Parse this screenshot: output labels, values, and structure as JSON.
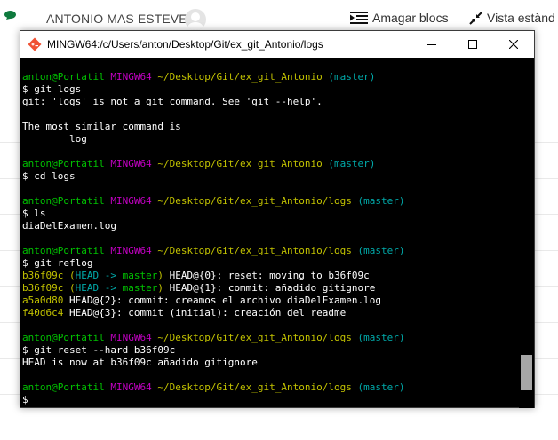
{
  "topbar": {
    "user_name": "ANTONIO MAS ESTEVE",
    "hide_blocks_label": "Amagar blocs",
    "standard_view_label": "Vista estànd"
  },
  "window": {
    "title": "MINGW64:/c/Users/anton/Desktop/Git/ex_git_Antonio/logs"
  },
  "terminal": {
    "lines": [
      {
        "segments": []
      },
      {
        "segments": [
          {
            "t": "anton@Portatil",
            "c": "green"
          },
          {
            "t": " ",
            "c": "white"
          },
          {
            "t": "MINGW64",
            "c": "purple"
          },
          {
            "t": " ",
            "c": "white"
          },
          {
            "t": "~/Desktop/Git/ex_git_Antonio",
            "c": "yellow"
          },
          {
            "t": " ",
            "c": "white"
          },
          {
            "t": "(master)",
            "c": "cyan"
          }
        ]
      },
      {
        "segments": [
          {
            "t": "$ git logs",
            "c": "white"
          }
        ]
      },
      {
        "segments": [
          {
            "t": "git: 'logs' is not a git command. See 'git --help'.",
            "c": "white"
          }
        ]
      },
      {
        "segments": []
      },
      {
        "segments": [
          {
            "t": "The most similar command is",
            "c": "white"
          }
        ]
      },
      {
        "segments": [
          {
            "t": "        log",
            "c": "white"
          }
        ]
      },
      {
        "segments": []
      },
      {
        "segments": [
          {
            "t": "anton@Portatil",
            "c": "green"
          },
          {
            "t": " ",
            "c": "white"
          },
          {
            "t": "MINGW64",
            "c": "purple"
          },
          {
            "t": " ",
            "c": "white"
          },
          {
            "t": "~/Desktop/Git/ex_git_Antonio",
            "c": "yellow"
          },
          {
            "t": " ",
            "c": "white"
          },
          {
            "t": "(master)",
            "c": "cyan"
          }
        ]
      },
      {
        "segments": [
          {
            "t": "$ cd logs",
            "c": "white"
          }
        ]
      },
      {
        "segments": []
      },
      {
        "segments": [
          {
            "t": "anton@Portatil",
            "c": "green"
          },
          {
            "t": " ",
            "c": "white"
          },
          {
            "t": "MINGW64",
            "c": "purple"
          },
          {
            "t": " ",
            "c": "white"
          },
          {
            "t": "~/Desktop/Git/ex_git_Antonio/logs",
            "c": "yellow"
          },
          {
            "t": " ",
            "c": "white"
          },
          {
            "t": "(master)",
            "c": "cyan"
          }
        ]
      },
      {
        "segments": [
          {
            "t": "$ ls",
            "c": "white"
          }
        ]
      },
      {
        "segments": [
          {
            "t": "diaDelExamen.log",
            "c": "white"
          }
        ]
      },
      {
        "segments": []
      },
      {
        "segments": [
          {
            "t": "anton@Portatil",
            "c": "green"
          },
          {
            "t": " ",
            "c": "white"
          },
          {
            "t": "MINGW64",
            "c": "purple"
          },
          {
            "t": " ",
            "c": "white"
          },
          {
            "t": "~/Desktop/Git/ex_git_Antonio/logs",
            "c": "yellow"
          },
          {
            "t": " ",
            "c": "white"
          },
          {
            "t": "(master)",
            "c": "cyan"
          }
        ]
      },
      {
        "segments": [
          {
            "t": "$ git reflog",
            "c": "white"
          }
        ]
      },
      {
        "segments": [
          {
            "t": "b36f09c",
            "c": "yellow"
          },
          {
            "t": " ",
            "c": "white"
          },
          {
            "t": "(",
            "c": "yellow"
          },
          {
            "t": "HEAD -> ",
            "c": "cyan"
          },
          {
            "t": "master",
            "c": "green"
          },
          {
            "t": ")",
            "c": "yellow"
          },
          {
            "t": " HEAD@{0}: reset: moving to b36f09c",
            "c": "white"
          }
        ]
      },
      {
        "segments": [
          {
            "t": "b36f09c",
            "c": "yellow"
          },
          {
            "t": " ",
            "c": "white"
          },
          {
            "t": "(",
            "c": "yellow"
          },
          {
            "t": "HEAD -> ",
            "c": "cyan"
          },
          {
            "t": "master",
            "c": "green"
          },
          {
            "t": ")",
            "c": "yellow"
          },
          {
            "t": " HEAD@{1}: commit: añadido gitignore",
            "c": "white"
          }
        ]
      },
      {
        "segments": [
          {
            "t": "a5a0d80",
            "c": "yellow"
          },
          {
            "t": " HEAD@{2}: commit: creamos el archivo diaDelExamen.log",
            "c": "white"
          }
        ]
      },
      {
        "segments": [
          {
            "t": "f40d6c4",
            "c": "yellow"
          },
          {
            "t": " HEAD@{3}: commit (initial): creación del readme",
            "c": "white"
          }
        ]
      },
      {
        "segments": []
      },
      {
        "segments": [
          {
            "t": "anton@Portatil",
            "c": "green"
          },
          {
            "t": " ",
            "c": "white"
          },
          {
            "t": "MINGW64",
            "c": "purple"
          },
          {
            "t": " ",
            "c": "white"
          },
          {
            "t": "~/Desktop/Git/ex_git_Antonio/logs",
            "c": "yellow"
          },
          {
            "t": " ",
            "c": "white"
          },
          {
            "t": "(master)",
            "c": "cyan"
          }
        ]
      },
      {
        "segments": [
          {
            "t": "$ git reset --hard b36f09c",
            "c": "white"
          }
        ]
      },
      {
        "segments": [
          {
            "t": "HEAD is now at b36f09c añadido gitignore",
            "c": "white"
          }
        ]
      },
      {
        "segments": []
      },
      {
        "segments": [
          {
            "t": "anton@Portatil",
            "c": "green"
          },
          {
            "t": " ",
            "c": "white"
          },
          {
            "t": "MINGW64",
            "c": "purple"
          },
          {
            "t": " ",
            "c": "white"
          },
          {
            "t": "~/Desktop/Git/ex_git_Antonio/logs",
            "c": "yellow"
          },
          {
            "t": " ",
            "c": "white"
          },
          {
            "t": "(master)",
            "c": "cyan"
          }
        ]
      },
      {
        "segments": [
          {
            "t": "$ ",
            "c": "white"
          }
        ],
        "cursor": true
      }
    ]
  }
}
